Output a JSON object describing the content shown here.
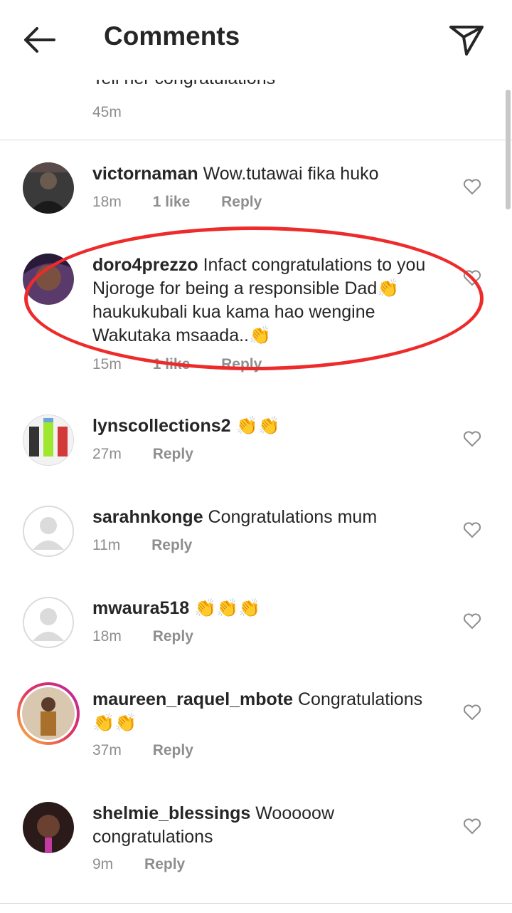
{
  "header": {
    "title": "Comments",
    "back_icon": "arrow-left-icon",
    "send_icon": "paper-plane-icon"
  },
  "partial_comment": {
    "text": "Tell her congratulations",
    "time": "45m"
  },
  "comments": [
    {
      "username": "victornaman",
      "text": " Wow.tutawai fika huko",
      "time": "18m",
      "likes": "1 like",
      "reply": "Reply"
    },
    {
      "username": "doro4prezzo",
      "text": " Infact congratulations to you Njoroge for being a responsible Dad👏 haukukubali kua kama hao wengine Wakutaka msaada..👏",
      "time": "15m",
      "likes": "1 like",
      "reply": "Reply"
    },
    {
      "username": "lynscollections2",
      "text": " 👏👏",
      "time": "27m",
      "reply": "Reply"
    },
    {
      "username": "sarahnkonge",
      "text": " Congratulations mum",
      "time": "11m",
      "reply": "Reply"
    },
    {
      "username": "mwaura518",
      "text": " 👏👏👏",
      "time": "18m",
      "reply": "Reply"
    },
    {
      "username": "maureen_raquel_mbote",
      "text": " Congratulations 👏👏",
      "time": "37m",
      "reply": "Reply"
    },
    {
      "username": "shelmie_blessings",
      "text": " Wooooow congratulations",
      "time": "9m",
      "reply": "Reply"
    }
  ],
  "colors": {
    "annotation": "#ee2b2b",
    "meta": "#8e8e8e",
    "text": "#262626"
  }
}
